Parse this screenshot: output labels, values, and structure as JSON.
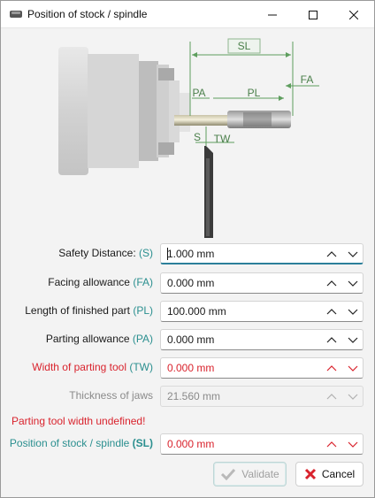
{
  "window": {
    "title": "Position of stock / spindle",
    "icon": "app-icon",
    "controls": [
      "minimize-icon",
      "maximize-icon",
      "close-icon"
    ]
  },
  "diagram": {
    "labels": {
      "sl": "SL",
      "fa": "FA",
      "pa": "PA",
      "pl": "PL",
      "s": "S",
      "tw": "TW"
    }
  },
  "fields": [
    {
      "label": "Safety Distance: ",
      "code": "(S)",
      "value": "1.000 mm",
      "state": "focused"
    },
    {
      "label": "Facing allowance ",
      "code": "(FA)",
      "value": "0.000 mm",
      "state": "normal"
    },
    {
      "label": "Length of finished part ",
      "code": "(PL)",
      "value": "100.000 mm",
      "state": "normal"
    },
    {
      "label": "Parting allowance ",
      "code": "(PA)",
      "value": "0.000 mm",
      "state": "normal"
    },
    {
      "label": "Width of parting tool ",
      "code": "(TW)",
      "value": "0.000 mm",
      "state": "error"
    },
    {
      "label": "Thickness of jaws",
      "code": "",
      "value": "21.560 mm",
      "state": "disabled"
    },
    {
      "label": "Position of stock / spindle ",
      "code": "(SL)",
      "value": "0.000 mm",
      "state": "error"
    }
  ],
  "error_message": "Parting tool width undefined!",
  "buttons": {
    "validate": "Validate",
    "cancel": "Cancel"
  },
  "colors": {
    "accent": "#2a8f8f",
    "error": "#d9232d",
    "focus": "#2b7f9a",
    "dimension": "#5e9e5e"
  }
}
